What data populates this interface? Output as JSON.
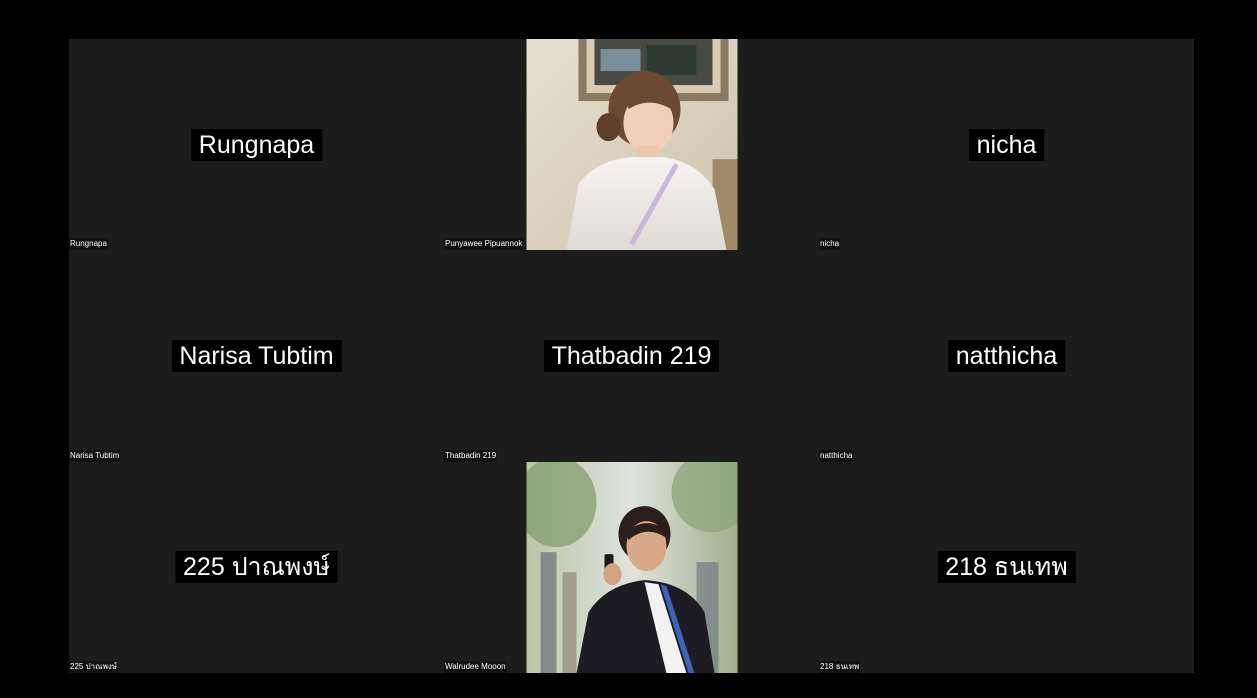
{
  "participants": [
    {
      "display_name": "Rungnapa",
      "label": "Rungnapa",
      "video": false
    },
    {
      "display_name": "",
      "label": "Punyawee Pipuannok",
      "video": true,
      "video_icon": "person-portrait-white-shirt"
    },
    {
      "display_name": "nicha",
      "label": "nicha",
      "video": false
    },
    {
      "display_name": "Narisa Tubtim",
      "label": "Narisa Tubtim",
      "video": false
    },
    {
      "display_name": "Thatbadin 219",
      "label": "Thatbadin 219",
      "video": false
    },
    {
      "display_name": "natthicha",
      "label": "natthicha",
      "video": false
    },
    {
      "display_name": "225 ปาณพงษ์",
      "label": "225 ปาณพงษ์",
      "video": false
    },
    {
      "display_name": "",
      "label": "Walrudee Mooon",
      "video": true,
      "video_icon": "person-portrait-graduation-gown"
    },
    {
      "display_name": "218 ธนเทพ",
      "label": "218 ธนเทพ",
      "video": false
    }
  ],
  "colors": {
    "background": "#000000",
    "tile": "#1c1c1c",
    "text": "#ffffff"
  }
}
